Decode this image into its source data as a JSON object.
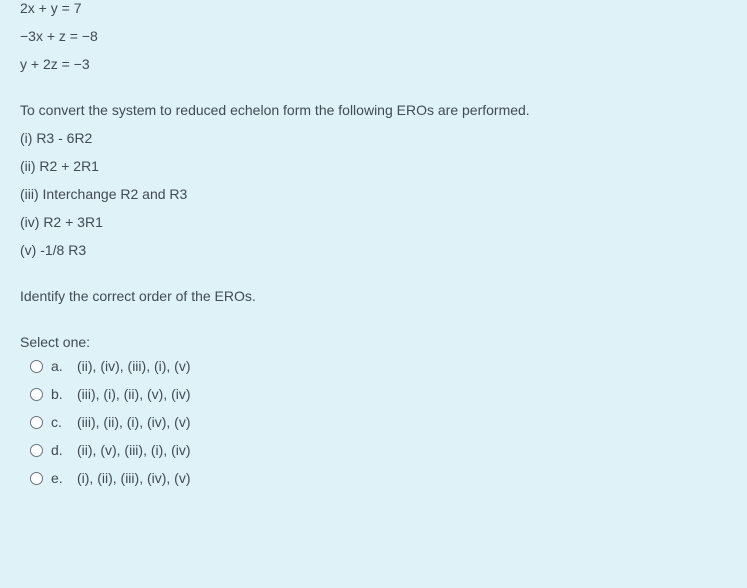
{
  "equations": [
    "2x + y = 7",
    "−3x + z = −8",
    "y + 2z = −3"
  ],
  "description": "To convert the system to reduced echelon form the following EROs are performed.",
  "eros": [
    "(i) R3 - 6R2",
    "(ii) R2 + 2R1",
    "(iii) Interchange R2 and R3",
    "(iv) R2 + 3R1",
    "(v) -1/8 R3"
  ],
  "identify": "Identify the correct order of the EROs.",
  "select_label": "Select one:",
  "options": [
    {
      "letter": "a.",
      "text": "(ii), (iv), (iii), (i), (v)"
    },
    {
      "letter": "b.",
      "text": "(iii), (i), (ii), (v), (iv)"
    },
    {
      "letter": "c.",
      "text": "(iii), (ii), (i), (iv), (v)"
    },
    {
      "letter": "d.",
      "text": "(ii), (v), (iii), (i), (iv)"
    },
    {
      "letter": "e.",
      "text": "(i), (ii), (iii), (iv), (v)"
    }
  ]
}
